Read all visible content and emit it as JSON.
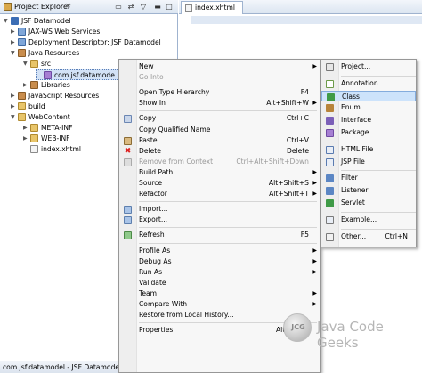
{
  "explorer": {
    "title": "Project Explorer",
    "close": "✕",
    "tree": [
      {
        "label": "JSF Datamodel",
        "icon": "project-icon",
        "twisty": "▼"
      },
      {
        "label": "JAX-WS Web Services",
        "icon": "web-services-icon",
        "twisty": "▶"
      },
      {
        "label": "Deployment Descriptor: JSF Datamodel",
        "icon": "deployment-descriptor-icon",
        "twisty": "▶"
      },
      {
        "label": "Java Resources",
        "icon": "java-resources-icon",
        "twisty": "▼"
      },
      {
        "label": "src",
        "icon": "source-folder-icon",
        "twisty": "▼"
      },
      {
        "label": "com.jsf.datamode",
        "icon": "package-icon",
        "twisty": ""
      },
      {
        "label": "Libraries",
        "icon": "libraries-icon",
        "twisty": "▶"
      },
      {
        "label": "JavaScript Resources",
        "icon": "javascript-resources-icon",
        "twisty": "▶"
      },
      {
        "label": "build",
        "icon": "folder-icon",
        "twisty": "▶"
      },
      {
        "label": "WebContent",
        "icon": "folder-icon",
        "twisty": "▼"
      },
      {
        "label": "META-INF",
        "icon": "folder-icon",
        "twisty": "▶"
      },
      {
        "label": "WEB-INF",
        "icon": "folder-icon",
        "twisty": "▶"
      },
      {
        "label": "index.xhtml",
        "icon": "file-icon",
        "twisty": ""
      }
    ]
  },
  "status": {
    "text": "com.jsf.datamodel - JSF Datamode"
  },
  "editor": {
    "tab_label": "index.xhtml"
  },
  "context_menu": [
    {
      "label": "New",
      "shortcut": "",
      "submenu": true,
      "enabled": true,
      "icon": ""
    },
    {
      "label": "Go Into",
      "shortcut": "",
      "submenu": false,
      "enabled": false,
      "icon": ""
    },
    {
      "sep": true
    },
    {
      "label": "Open Type Hierarchy",
      "shortcut": "F4",
      "submenu": false,
      "enabled": true,
      "icon": ""
    },
    {
      "label": "Show In",
      "shortcut": "Alt+Shift+W",
      "submenu": true,
      "enabled": true,
      "icon": ""
    },
    {
      "sep": true
    },
    {
      "label": "Copy",
      "shortcut": "Ctrl+C",
      "submenu": false,
      "enabled": true,
      "icon": "copy-icon"
    },
    {
      "label": "Copy Qualified Name",
      "shortcut": "",
      "submenu": false,
      "enabled": true,
      "icon": ""
    },
    {
      "label": "Paste",
      "shortcut": "Ctrl+V",
      "submenu": false,
      "enabled": true,
      "icon": "paste-icon"
    },
    {
      "label": "Delete",
      "shortcut": "Delete",
      "submenu": false,
      "enabled": true,
      "icon": "delete-icon"
    },
    {
      "label": "Remove from Context",
      "shortcut": "Ctrl+Alt+Shift+Down",
      "submenu": false,
      "enabled": false,
      "icon": "remove-context-icon"
    },
    {
      "label": "Build Path",
      "shortcut": "",
      "submenu": true,
      "enabled": true,
      "icon": ""
    },
    {
      "label": "Source",
      "shortcut": "Alt+Shift+S",
      "submenu": true,
      "enabled": true,
      "icon": ""
    },
    {
      "label": "Refactor",
      "shortcut": "Alt+Shift+T",
      "submenu": true,
      "enabled": true,
      "icon": ""
    },
    {
      "sep": true
    },
    {
      "label": "Import...",
      "shortcut": "",
      "submenu": false,
      "enabled": true,
      "icon": "import-icon"
    },
    {
      "label": "Export...",
      "shortcut": "",
      "submenu": false,
      "enabled": true,
      "icon": "export-icon"
    },
    {
      "sep": true
    },
    {
      "label": "Refresh",
      "shortcut": "F5",
      "submenu": false,
      "enabled": true,
      "icon": "refresh-icon"
    },
    {
      "sep": true
    },
    {
      "label": "Profile As",
      "shortcut": "",
      "submenu": true,
      "enabled": true,
      "icon": ""
    },
    {
      "label": "Debug As",
      "shortcut": "",
      "submenu": true,
      "enabled": true,
      "icon": ""
    },
    {
      "label": "Run As",
      "shortcut": "",
      "submenu": true,
      "enabled": true,
      "icon": ""
    },
    {
      "label": "Validate",
      "shortcut": "",
      "submenu": false,
      "enabled": true,
      "icon": ""
    },
    {
      "label": "Team",
      "shortcut": "",
      "submenu": true,
      "enabled": true,
      "icon": ""
    },
    {
      "label": "Compare With",
      "shortcut": "",
      "submenu": true,
      "enabled": true,
      "icon": ""
    },
    {
      "label": "Restore from Local History...",
      "shortcut": "",
      "submenu": false,
      "enabled": true,
      "icon": ""
    },
    {
      "sep": true
    },
    {
      "label": "Properties",
      "shortcut": "Alt+Enter",
      "submenu": false,
      "enabled": true,
      "icon": ""
    }
  ],
  "new_submenu": [
    {
      "label": "Project...",
      "shortcut": "",
      "icon": "project-wizard-icon"
    },
    {
      "sep": true
    },
    {
      "label": "Annotation",
      "shortcut": "",
      "icon": "annotation-icon"
    },
    {
      "label": "Class",
      "shortcut": "",
      "icon": "class-icon",
      "highlighted": true
    },
    {
      "label": "Enum",
      "shortcut": "",
      "icon": "enum-icon"
    },
    {
      "label": "Interface",
      "shortcut": "",
      "icon": "interface-icon"
    },
    {
      "label": "Package",
      "shortcut": "",
      "icon": "package-icon"
    },
    {
      "sep": true
    },
    {
      "label": "HTML File",
      "shortcut": "",
      "icon": "html-file-icon"
    },
    {
      "label": "JSP File",
      "shortcut": "",
      "icon": "jsp-file-icon"
    },
    {
      "sep": true
    },
    {
      "label": "Filter",
      "shortcut": "",
      "icon": "filter-icon"
    },
    {
      "label": "Listener",
      "shortcut": "",
      "icon": "listener-icon"
    },
    {
      "label": "Servlet",
      "shortcut": "",
      "icon": "servlet-icon"
    },
    {
      "sep": true
    },
    {
      "label": "Example...",
      "shortcut": "",
      "icon": "example-icon"
    },
    {
      "sep": true
    },
    {
      "label": "Other...",
      "shortcut": "Ctrl+N",
      "icon": "other-icon"
    }
  ],
  "watermark": {
    "logo": "JCG",
    "text": "Java Code Geeks"
  },
  "colors": {
    "selection": "#d3e2f6",
    "highlight": "#cde3fb",
    "menu_bg": "#f7f7f7"
  }
}
